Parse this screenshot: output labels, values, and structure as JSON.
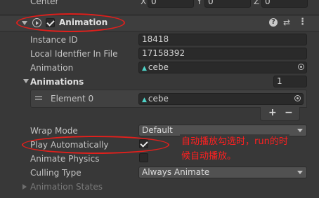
{
  "transform": {
    "center_label": "Center",
    "x_label": "X",
    "x_value": "0",
    "y_label": "Y",
    "y_value": "0",
    "z_label": "Z",
    "z_value": "0"
  },
  "component": {
    "title": "Animation",
    "enabled": true
  },
  "fields": {
    "instance_id_label": "Instance ID",
    "instance_id_value": "18418",
    "local_id_label": "Local Identfier In File",
    "local_id_value": "17158392",
    "animation_label": "Animation",
    "animation_value": "cebe",
    "animations_label": "Animations",
    "animations_count": "1",
    "element0_label": "Element 0",
    "element0_value": "cebe",
    "add_label": "+",
    "remove_label": "−",
    "wrap_mode_label": "Wrap Mode",
    "wrap_mode_value": "Default",
    "play_auto_label": "Play Automatically",
    "play_auto_checked": true,
    "animate_physics_label": "Animate Physics",
    "animate_physics_checked": false,
    "culling_type_label": "Culling Type",
    "culling_type_value": "Always Animate",
    "animation_states_label": "Animation States"
  },
  "annotation": {
    "line1": "自动播放勾选时，run的时",
    "line2": "候自动播放。",
    "color": "#ff2020"
  }
}
